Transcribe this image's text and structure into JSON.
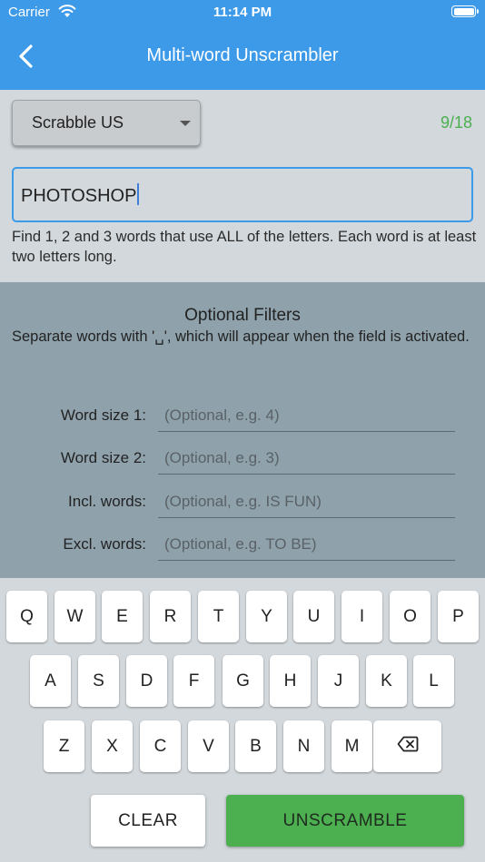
{
  "status_bar": {
    "carrier": "Carrier",
    "time": "11:14 PM"
  },
  "nav": {
    "title": "Multi-word Unscrambler",
    "back_icon": "chevron-left-icon"
  },
  "dictionary": {
    "selected": "Scrabble US"
  },
  "letter_count": "9/18",
  "letters_input": {
    "value": "PHOTOSHOP"
  },
  "instructions": "Find 1, 2 and 3 words that use ALL of the letters. Each word is at least two letters long.",
  "filters": {
    "title": "Optional Filters",
    "note": "Separate words with '␣', which will appear when the field is activated.",
    "rows": [
      {
        "label": "Word size 1:",
        "placeholder": "(Optional, e.g. 4)"
      },
      {
        "label": "Word size 2:",
        "placeholder": "(Optional, e.g. 3)"
      },
      {
        "label": "Incl. words:",
        "placeholder": "(Optional, e.g. IS FUN)"
      },
      {
        "label": "Excl. words:",
        "placeholder": "(Optional, e.g. TO BE)"
      }
    ]
  },
  "keyboard": {
    "row1": [
      "Q",
      "W",
      "E",
      "R",
      "T",
      "Y",
      "U",
      "I",
      "O",
      "P"
    ],
    "row2": [
      "A",
      "S",
      "D",
      "F",
      "G",
      "H",
      "J",
      "K",
      "L"
    ],
    "row3": [
      "Z",
      "X",
      "C",
      "V",
      "B",
      "N",
      "M"
    ],
    "backspace_icon": "backspace-icon"
  },
  "actions": {
    "clear": "CLEAR",
    "unscramble": "UNSCRAMBLE"
  },
  "colors": {
    "accent": "#3d9ae9",
    "success": "#4caf50",
    "filters_bg": "#8fa2ac",
    "page_bg": "#d2d8dc"
  }
}
